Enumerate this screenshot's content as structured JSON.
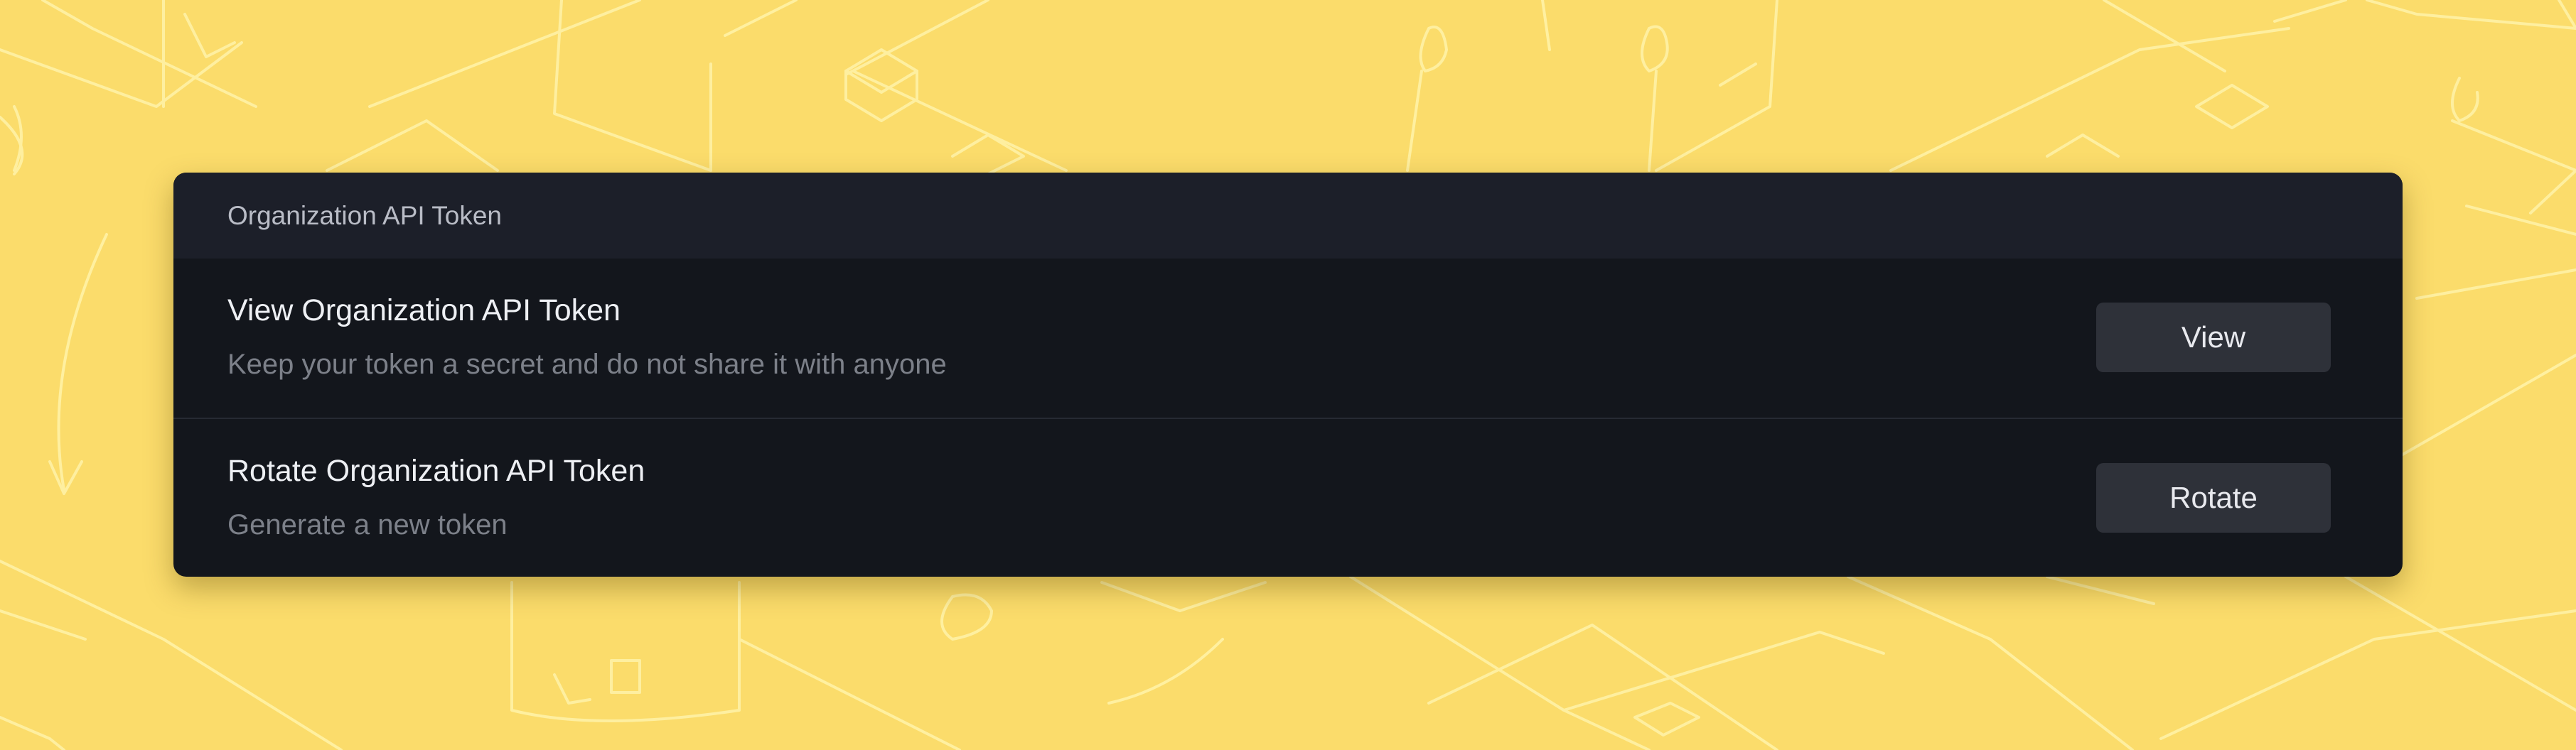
{
  "colors": {
    "background": "#fbdc6b",
    "sketch_lines": "#fff2a6",
    "card": "#13161c",
    "card_header": "#1c1f29",
    "button": "#2e3139",
    "title_text": "#eef0f4",
    "muted_text": "#7c8089"
  },
  "card": {
    "header_title": "Organization API Token",
    "rows": [
      {
        "title": "View Organization API Token",
        "description": "Keep your token a secret and do not share it with anyone",
        "button_label": "View"
      },
      {
        "title": "Rotate Organization API Token",
        "description": "Generate a new token",
        "button_label": "Rotate"
      }
    ]
  }
}
